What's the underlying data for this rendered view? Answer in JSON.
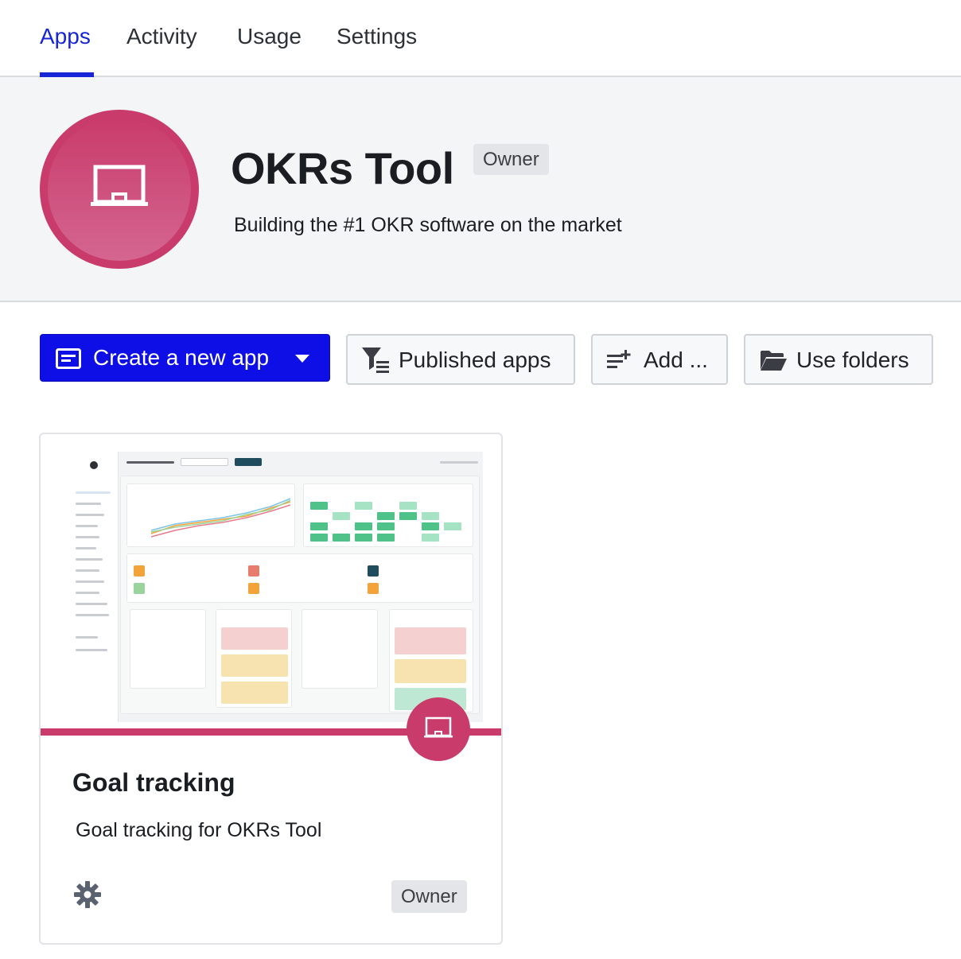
{
  "tabs": [
    {
      "label": "Apps",
      "active": true
    },
    {
      "label": "Activity",
      "active": false
    },
    {
      "label": "Usage",
      "active": false
    },
    {
      "label": "Settings",
      "active": false
    }
  ],
  "header": {
    "title": "OKRs Tool",
    "role_badge": "Owner",
    "description": "Building the #1 OKR software on the market",
    "logo_icon": "whiteboard-icon",
    "accent_color": "#c93b6a"
  },
  "toolbar": {
    "create_label": "Create a new app",
    "create_icon": "app-window-icon",
    "create_dropdown_icon": "caret-down-icon",
    "published_label": "Published apps",
    "published_icon": "filter-list-icon",
    "add_label": "Add ...",
    "add_icon": "add-list-icon",
    "folders_label": "Use folders",
    "folders_icon": "folder-open-icon",
    "primary_color": "#0d0fe6"
  },
  "apps": [
    {
      "title": "Goal tracking",
      "description": "Goal tracking for OKRs Tool",
      "role_badge": "Owner",
      "icon": "whiteboard-icon",
      "settings_icon": "gear-icon",
      "preview": "dashboard-screenshot"
    }
  ]
}
